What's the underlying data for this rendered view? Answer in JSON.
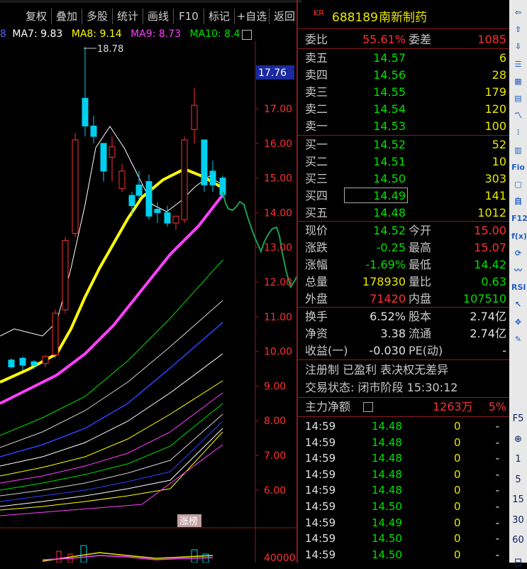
{
  "toolbar": {
    "buttons": [
      "复权",
      "叠加",
      "多股",
      "统计",
      "画线",
      "F10",
      "标记",
      "+自选",
      "返回"
    ]
  },
  "indicator": {
    "items": [
      {
        "label": "MA7: 9.83",
        "color": "#ffffff"
      },
      {
        "label": "MA8: 9.14",
        "color": "#ffff00"
      },
      {
        "label": "MA9: 8.73",
        "color": "#ff40ff"
      },
      {
        "label": "MA10: 8.4",
        "color": "#00e000"
      }
    ],
    "prefix": "8"
  },
  "chart": {
    "high_label": "18.78",
    "current_price": "17.76",
    "price_ticks": [
      "17.00",
      "16.00",
      "15.00",
      "14.00",
      "13.00",
      "12.00",
      "11.00",
      "10.00",
      "9.00",
      "8.00",
      "7.00",
      "6.00"
    ],
    "badge": "涨榜",
    "volume_tick": "40000"
  },
  "header": {
    "prefix": "KR",
    "code": "688189",
    "name": "南新制药"
  },
  "ratio": {
    "label1": "委比",
    "value1": "55.61%",
    "label2": "委差",
    "value2": "1085"
  },
  "asks": [
    {
      "label": "卖五",
      "price": "14.57",
      "vol": "6"
    },
    {
      "label": "卖四",
      "price": "14.56",
      "vol": "28"
    },
    {
      "label": "卖三",
      "price": "14.55",
      "vol": "179"
    },
    {
      "label": "卖二",
      "price": "14.54",
      "vol": "120"
    },
    {
      "label": "卖一",
      "price": "14.53",
      "vol": "100"
    }
  ],
  "bids": [
    {
      "label": "买一",
      "price": "14.52",
      "vol": "52"
    },
    {
      "label": "买二",
      "price": "14.51",
      "vol": "10"
    },
    {
      "label": "买三",
      "price": "14.50",
      "vol": "303"
    },
    {
      "label": "买四",
      "price": "14.49",
      "vol": "141"
    },
    {
      "label": "买五",
      "price": "14.48",
      "vol": "1012"
    }
  ],
  "quote": [
    {
      "l1": "现价",
      "v1": "14.52",
      "l2": "今开",
      "v2": "15.00",
      "c1": "g",
      "c2": "r"
    },
    {
      "l1": "涨跌",
      "v1": "-0.25",
      "l2": "最高",
      "v2": "15.07",
      "c1": "g",
      "c2": "r"
    },
    {
      "l1": "涨幅",
      "v1": "-1.69%",
      "l2": "最低",
      "v2": "14.42",
      "c1": "g",
      "c2": "g"
    },
    {
      "l1": "总量",
      "v1": "178930",
      "l2": "量比",
      "v2": "0.63",
      "c1": "y",
      "c2": "g"
    },
    {
      "l1": "外盘",
      "v1": "71420",
      "l2": "内盘",
      "v2": "107510",
      "c1": "r",
      "c2": "g"
    }
  ],
  "fundamentals": [
    {
      "l1": "换手",
      "v1": "6.52%",
      "l2": "股本",
      "v2": "2.74亿"
    },
    {
      "l1": "净资",
      "v1": "3.38",
      "l2": "流通",
      "v2": "2.74亿"
    },
    {
      "l1": "收益(一)",
      "v1": "-0.030",
      "l2": "PE(动)",
      "v2": "-"
    }
  ],
  "tags": "注册制 已盈利 表决权无差异",
  "status": "交易状态: 闭市阶段 15:30:12",
  "mainflow": {
    "label": "主力净额",
    "value": "1263万",
    "pct": "5%"
  },
  "ticks": [
    {
      "time": "14:59",
      "price": "14.48",
      "vol": "0",
      "flag": "-"
    },
    {
      "time": "14:59",
      "price": "14.48",
      "vol": "0",
      "flag": "-"
    },
    {
      "time": "14:59",
      "price": "14.48",
      "vol": "0",
      "flag": "-"
    },
    {
      "time": "14:59",
      "price": "14.48",
      "vol": "0",
      "flag": "-"
    },
    {
      "time": "14:59",
      "price": "14.48",
      "vol": "0",
      "flag": "-"
    },
    {
      "time": "14:59",
      "price": "14.50",
      "vol": "0",
      "flag": "-"
    },
    {
      "time": "14:59",
      "price": "14.49",
      "vol": "0",
      "flag": "-"
    },
    {
      "time": "14:59",
      "price": "14.50",
      "vol": "0",
      "flag": "-"
    },
    {
      "time": "14:59",
      "price": "14.50",
      "vol": "0",
      "flag": "-"
    }
  ],
  "side": {
    "icons": [
      "arrow-left-icon",
      "arrow-up-icon",
      "arrow-down-icon",
      "list-icon",
      "grid-icon",
      "calendar-icon",
      "line-chart-icon",
      "candle-icon",
      "table-icon",
      "f10-icon",
      "news-icon",
      "self-select-icon",
      "f12-icon",
      "fx-icon",
      "refresh-icon",
      "wave-icon",
      "rsi-icon",
      "cursor-icon",
      "move-icon",
      "pen-icon"
    ],
    "labels": [
      "⇦",
      "⇧",
      "⇩",
      "☰",
      "▦",
      "▤",
      "〽",
      "⫶",
      "▥",
      "Fio",
      "▢",
      "自",
      "F12",
      "f(x)",
      "⟳",
      "〰",
      "RSI",
      "↖",
      "✥",
      "✎"
    ],
    "periods": [
      "F5",
      "⊕",
      "1",
      "5",
      "15",
      "30",
      "60",
      "日"
    ]
  }
}
